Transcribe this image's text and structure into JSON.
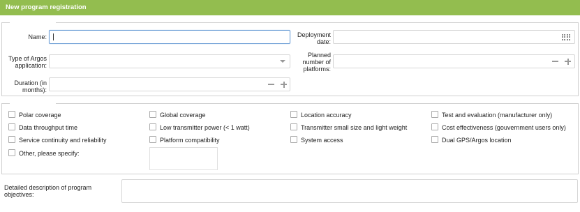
{
  "header": {
    "title": "New program registration"
  },
  "form": {
    "name_label": "Name:",
    "name_value": "",
    "deployment_date_label_1": "Deployment",
    "deployment_date_label_2": "date:",
    "argos_app_label_1": "Type of Argos",
    "argos_app_label_2": "application:",
    "planned_platforms_label_1": "Planned",
    "planned_platforms_label_2": "number of",
    "planned_platforms_label_3": "platforms:",
    "duration_label_1": "Duration (in",
    "duration_label_2": "months):"
  },
  "checkboxes": {
    "polar_coverage": "Polar coverage",
    "global_coverage": "Global coverage",
    "location_accuracy": "Location accuracy",
    "test_evaluation": "Test and evaluation (manufacturer only)",
    "data_throughput": "Data throughput time",
    "low_power": "Low transmitter power (< 1 watt)",
    "small_size": "Transmitter small size and light weight",
    "cost_effectiveness": "Cost effectiveness (gouvernment users only)",
    "service_continuity": "Service continuity and reliability",
    "platform_compat": "Platform compatibility",
    "system_access": "System access",
    "dual_gps": "Dual GPS/Argos location",
    "other": "Other, please specify:"
  },
  "description": {
    "label": "Detailed description of program objectives:"
  },
  "icons": {
    "calendar": "calendar-icon",
    "dropdown": "chevron-down-icon",
    "minus": "minus-icon",
    "plus": "plus-icon"
  }
}
